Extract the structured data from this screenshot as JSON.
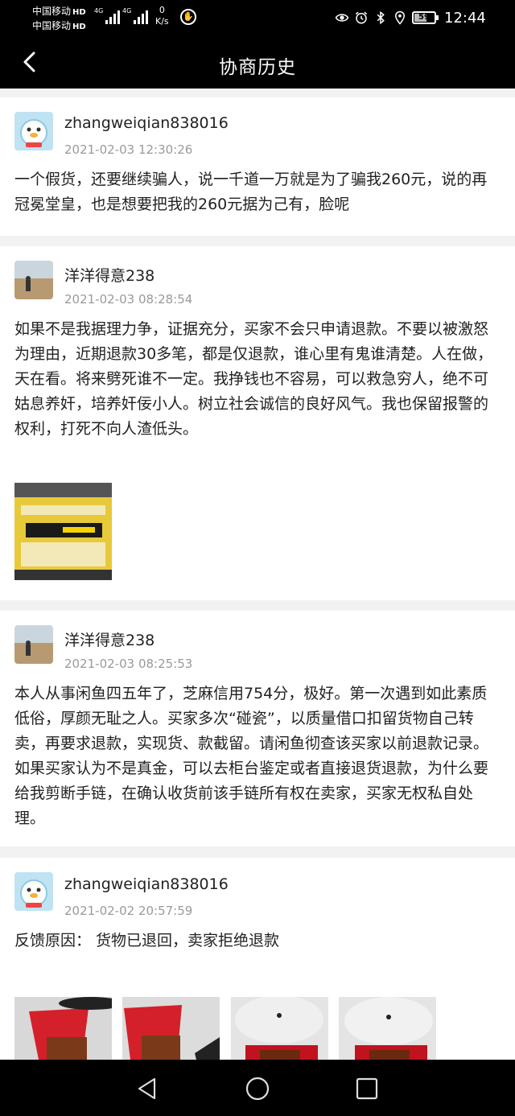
{
  "status_bar": {
    "carrier1": "中国移动",
    "carrier2": "中国移动",
    "hd": "HD",
    "net1": "4G",
    "net2": "4G",
    "speed_value": "0",
    "speed_unit": "K/s",
    "battery": "59",
    "time": "12:44",
    "icons": [
      "hand-icon",
      "eye-icon",
      "alarm-icon",
      "bluetooth-icon",
      "location-icon",
      "battery-icon"
    ]
  },
  "header": {
    "title": "协商历史"
  },
  "records": [
    {
      "user": "zhangweiqian838016",
      "time": "2021-02-03 12:30:26",
      "text": "一个假货，还要继续骗人，说一千道一万就是为了骗我260元，说的再冠冕堂皇，也是想要把我的260元据为己有，脸呢"
    },
    {
      "user": "洋洋得意238",
      "time": "2021-02-03 08:28:54",
      "text": "如果不是我据理力争，证据充分，买家不会只申请退款。不要以被激怒为理由，近期退款30多笔，都是仅退款，谁心里有鬼谁清楚。人在做，天在看。将来劈死谁不一定。我挣钱也不容易，可以救急穷人，绝不可姑息养奸，培养奸佞小人。树立社会诚信的良好风气。我也保留报警的权利，打死不向人渣低头。"
    },
    {
      "user": "洋洋得意238",
      "time": "2021-02-03 08:25:53",
      "text": "本人从事闲鱼四五年了，芝麻信用754分，极好。第一次遇到如此素质低俗，厚颜无耻之人。买家多次“碰瓷”，以质量借口扣留货物自己转卖，再要求退款，实现货、款截留。请闲鱼彻查该买家以前退款记录。如果买家认为不是真金，可以去柜台鉴定或者直接退货退款，为什么要给我剪断手链，在确认收货前该手链所有权在卖家，买家无权私自处理。"
    },
    {
      "user": "zhangweiqian838016",
      "time": "2021-02-02 20:57:59",
      "text": "反馈原因： 货物已退回，卖家拒绝退款"
    }
  ],
  "nav": {
    "icons": [
      "back-triangle-icon",
      "home-circle-icon",
      "recents-square-icon"
    ]
  }
}
